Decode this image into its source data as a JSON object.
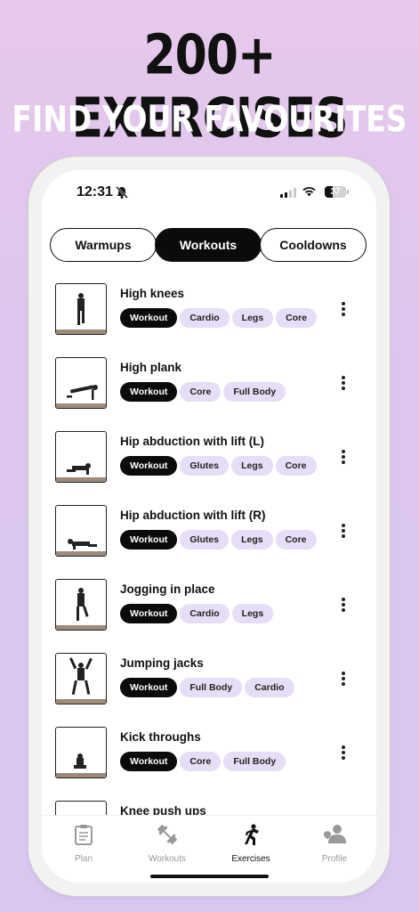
{
  "promo": {
    "headline": "200+ EXERCISES",
    "subheadline": "FIND YOUR FAVOURITES"
  },
  "status_bar": {
    "time": "12:31",
    "battery": "37",
    "battery_level": 0.37
  },
  "tabs": [
    {
      "label": "Warmups",
      "active": false
    },
    {
      "label": "Workouts",
      "active": true
    },
    {
      "label": "Cooldowns",
      "active": false
    }
  ],
  "exercises": [
    {
      "name": "High knees",
      "tags": [
        "Workout",
        "Cardio",
        "Legs",
        "Core"
      ]
    },
    {
      "name": "High plank",
      "tags": [
        "Workout",
        "Core",
        "Full Body"
      ]
    },
    {
      "name": "Hip abduction with lift (L)",
      "tags": [
        "Workout",
        "Glutes",
        "Legs",
        "Core"
      ]
    },
    {
      "name": "Hip abduction with lift (R)",
      "tags": [
        "Workout",
        "Glutes",
        "Legs",
        "Core"
      ]
    },
    {
      "name": "Jogging in place",
      "tags": [
        "Workout",
        "Cardio",
        "Legs"
      ]
    },
    {
      "name": "Jumping jacks",
      "tags": [
        "Workout",
        "Full Body",
        "Cardio"
      ]
    },
    {
      "name": "Kick throughs",
      "tags": [
        "Workout",
        "Core",
        "Full Body"
      ]
    },
    {
      "name": "Knee push ups",
      "tags": []
    }
  ],
  "tab_bar": [
    {
      "label": "Plan",
      "icon": "clipboard-icon",
      "active": false
    },
    {
      "label": "Workouts",
      "icon": "dumbbell-icon",
      "active": false
    },
    {
      "label": "Exercises",
      "icon": "running-person-icon",
      "active": true
    },
    {
      "label": "Profile",
      "icon": "people-icon",
      "active": false
    }
  ],
  "colors": {
    "accent": "#0b0b0b",
    "tag_bg": "#e6ddf6",
    "background_top": "#e6c8ec",
    "background_bottom": "#d9c7f2"
  }
}
